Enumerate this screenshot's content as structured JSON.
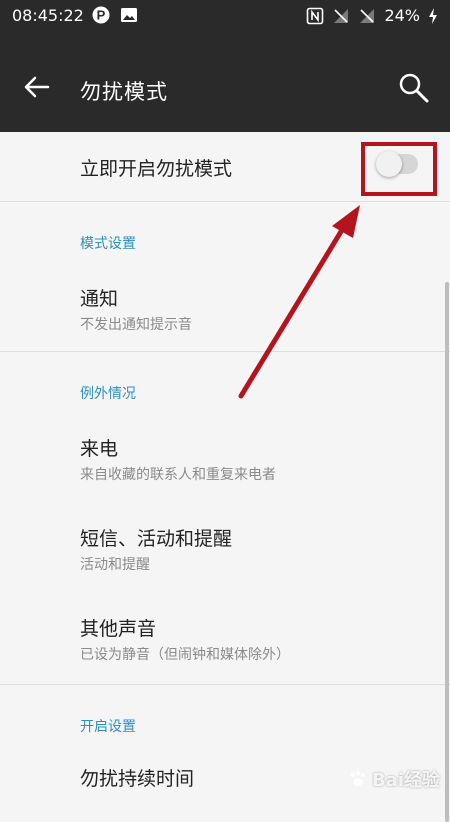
{
  "status_bar": {
    "time": "08:45:22",
    "battery": "24%",
    "left_icons": [
      "parking-icon",
      "image-icon"
    ],
    "right_icons": [
      "nfc-icon",
      "signal-off-icon",
      "signal-off-icon",
      "battery-charging-icon"
    ]
  },
  "app_bar": {
    "title": "勿扰模式",
    "back_icon": "arrow-left-icon",
    "search_icon": "search-icon"
  },
  "main_toggle": {
    "label": "立即开启勿扰模式",
    "enabled": false
  },
  "sections": [
    {
      "header": "模式设置",
      "items": [
        {
          "title": "通知",
          "subtitle": "不发出通知提示音"
        }
      ]
    },
    {
      "header": "例外情况",
      "items": [
        {
          "title": "来电",
          "subtitle": "来自收藏的联系人和重复来电者"
        },
        {
          "title": "短信、活动和提醒",
          "subtitle": "活动和提醒"
        },
        {
          "title": "其他声音",
          "subtitle": "已设为静音（但闹钟和媒体除外）"
        }
      ]
    },
    {
      "header": "开启设置",
      "items": [
        {
          "title": "勿扰持续时间",
          "subtitle": ""
        }
      ]
    }
  ],
  "annotation": {
    "color": "#b4141e"
  },
  "watermark": {
    "text": "Bai经验"
  },
  "colors": {
    "app_bar": "#2a2a2a",
    "section_header": "#2c8fc5",
    "background": "#f5f5f5"
  }
}
